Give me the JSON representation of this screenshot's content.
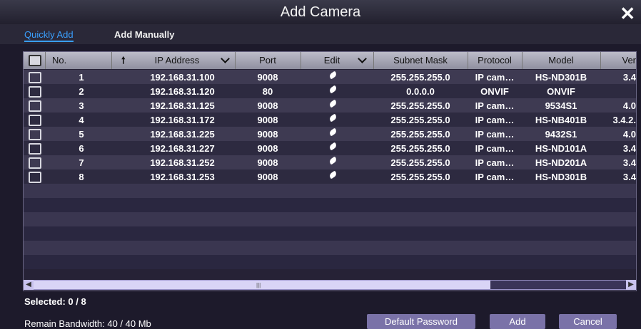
{
  "window": {
    "title": "Add Camera",
    "close_glyph": "✕"
  },
  "tabs": [
    {
      "label": "Quickly Add",
      "active": true
    },
    {
      "label": "Add Manually",
      "active": false
    }
  ],
  "table": {
    "columns": {
      "no": "No.",
      "ip": "IP Address",
      "port": "Port",
      "edit": "Edit",
      "subnet": "Subnet Mask",
      "protocol": "Protocol",
      "model": "Model",
      "version": "Ver"
    },
    "rows": [
      {
        "no": "1",
        "ip": "192.168.31.100",
        "port": "9008",
        "subnet": "255.255.255.0",
        "protocol": "IP cam…",
        "model": "HS-ND301B",
        "version": "3.4"
      },
      {
        "no": "2",
        "ip": "192.168.31.120",
        "port": "80",
        "subnet": "0.0.0.0",
        "protocol": "ONVIF",
        "model": "ONVIF",
        "version": ""
      },
      {
        "no": "3",
        "ip": "192.168.31.125",
        "port": "9008",
        "subnet": "255.255.255.0",
        "protocol": "IP cam…",
        "model": "9534S1",
        "version": "4.0"
      },
      {
        "no": "4",
        "ip": "192.168.31.172",
        "port": "9008",
        "subnet": "255.255.255.0",
        "protocol": "IP cam…",
        "model": "HS-NB401B",
        "version": "3.4.2."
      },
      {
        "no": "5",
        "ip": "192.168.31.225",
        "port": "9008",
        "subnet": "255.255.255.0",
        "protocol": "IP cam…",
        "model": "9432S1",
        "version": "4.0"
      },
      {
        "no": "6",
        "ip": "192.168.31.227",
        "port": "9008",
        "subnet": "255.255.255.0",
        "protocol": "IP cam…",
        "model": "HS-ND101A",
        "version": "3.4"
      },
      {
        "no": "7",
        "ip": "192.168.31.252",
        "port": "9008",
        "subnet": "255.255.255.0",
        "protocol": "IP cam…",
        "model": "HS-ND201A",
        "version": "3.4"
      },
      {
        "no": "8",
        "ip": "192.168.31.253",
        "port": "9008",
        "subnet": "255.255.255.0",
        "protocol": "IP cam…",
        "model": "HS-ND301B",
        "version": "3.4"
      }
    ],
    "sort_icon": "arrow-up-icon",
    "edit_icon": "pencil-icon"
  },
  "status": {
    "selected": "Selected: 0 / 8",
    "bandwidth": "Remain Bandwidth: 40 / 40 Mb"
  },
  "buttons": {
    "default_password": "Default Password",
    "add": "Add",
    "cancel": "Cancel"
  },
  "colors": {
    "accent": "#3aa0ff",
    "button": "#7a72a8",
    "scrollbar": "#9a93c8"
  }
}
